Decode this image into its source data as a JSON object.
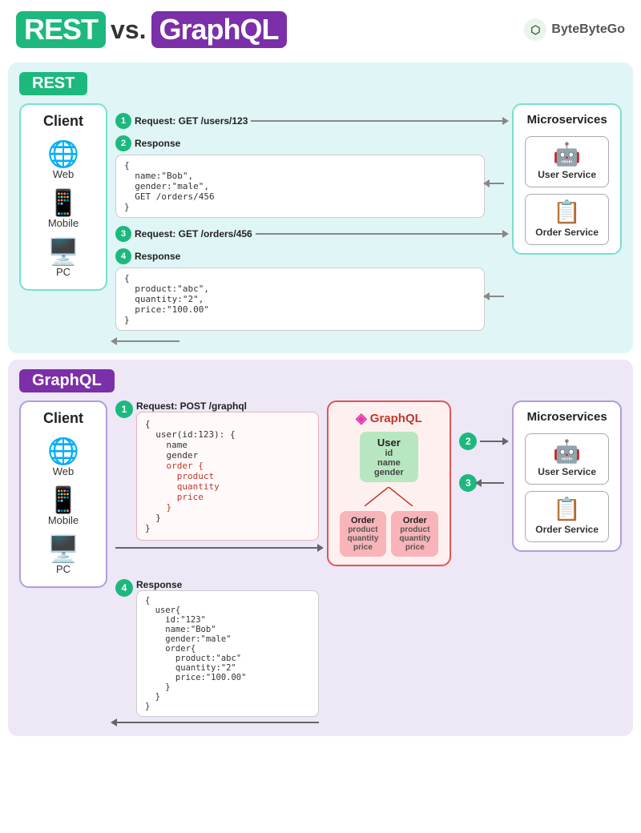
{
  "header": {
    "rest_label": "REST",
    "vs": "vs.",
    "graphql_label": "GraphQL",
    "brand": "ByteByteGo"
  },
  "rest_section": {
    "label": "REST",
    "client_title": "Client",
    "devices": [
      "Web",
      "Mobile",
      "PC"
    ],
    "microservices_title": "Microservices",
    "steps": [
      {
        "num": "1",
        "label": "Request: GET /users/123",
        "direction": "right"
      },
      {
        "num": "2",
        "label": "Response",
        "direction": "left",
        "response": "{\n  name:\"Bob\",\n  gender:\"male\",\n  GET /orders/456\n}"
      },
      {
        "num": "3",
        "label": "Request: GET /orders/456",
        "direction": "right"
      },
      {
        "num": "4",
        "label": "Response",
        "direction": "left",
        "response": "{\n  product:\"abc\",\n  quantity:\"2\",\n  price:\"100.00\"\n}"
      }
    ],
    "user_service_label": "User Service",
    "order_service_label": "Order Service"
  },
  "graphql_section": {
    "label": "GraphQL",
    "client_title": "Client",
    "devices": [
      "Web",
      "Mobile",
      "PC"
    ],
    "microservices_title": "Microservices",
    "request_step": "1",
    "request_label": "Request: POST /graphql",
    "request_body": "{\n  user(id:123): {\n    name\n    gender\n    order {\n      product\n      quantity\n      price\n    }\n  }\n}",
    "graphql_server_title": "GraphQL",
    "user_node": "User",
    "user_fields": "id\nname\ngender",
    "order_node1": "Order",
    "order_fields1": "product\nquantity\nprice",
    "order_node2": "Order",
    "order_fields2": "product\nquantity\nprice",
    "response_step": "4",
    "response_label": "Response",
    "response_body": "{\n  user{\n    id:\"123\"\n    name:\"Bob\"\n    gender:\"male\"\n    order{\n      product:\"abc\"\n      quantity:\"2\"\n      price:\"100.00\"\n    }\n  }\n}",
    "step2": "2",
    "step3": "3",
    "user_service_label": "User Service",
    "order_service_label": "Order Service"
  }
}
